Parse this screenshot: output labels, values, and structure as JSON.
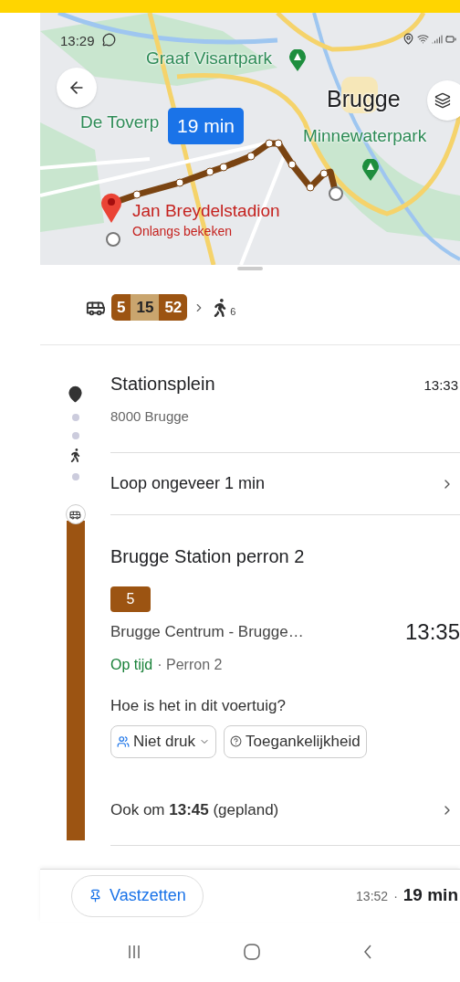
{
  "status_bar": {
    "time": "13:29"
  },
  "map": {
    "labels": [
      {
        "text": "Graaf Visartpark",
        "kind": "park"
      },
      {
        "text": "Brugge",
        "kind": "city"
      },
      {
        "text": "De Toverp",
        "kind": "park"
      },
      {
        "text": "Minnewaterpark",
        "kind": "park"
      }
    ],
    "duration": "19 min",
    "destination": "Jan Breydelstadion",
    "destination_note": "Onlangs bekeken"
  },
  "summary": {
    "lines": [
      {
        "number": "5",
        "color": "#9c5412"
      },
      {
        "number": "15",
        "color": "#c9a56e"
      },
      {
        "number": "52",
        "color": "#9c5412"
      }
    ],
    "walk_minutes": "6"
  },
  "origin": {
    "name": "Stationsplein",
    "address": "8000 Brugge",
    "time": "13:33"
  },
  "walk": {
    "label": "Loop ongeveer 1 min"
  },
  "transit": {
    "stop": "Brugge Station perron 2",
    "line": "5",
    "headsign": "Brugge Centrum - Brugge…",
    "departure": "13:35",
    "status": "Op tijd",
    "platform": "· Perron 2",
    "question": "Hoe is het in dit voertuig?",
    "chips": [
      {
        "label": "Niet druk",
        "kind": "crowding"
      },
      {
        "label": "Toegankelijkheid",
        "kind": "accessibility"
      }
    ],
    "also": "Ook om **13:45** (gepland)"
  },
  "bottom_bar": {
    "pin_button": "Vastzetten",
    "arrival": "13:52",
    "separator": "·",
    "duration": "19 min"
  }
}
